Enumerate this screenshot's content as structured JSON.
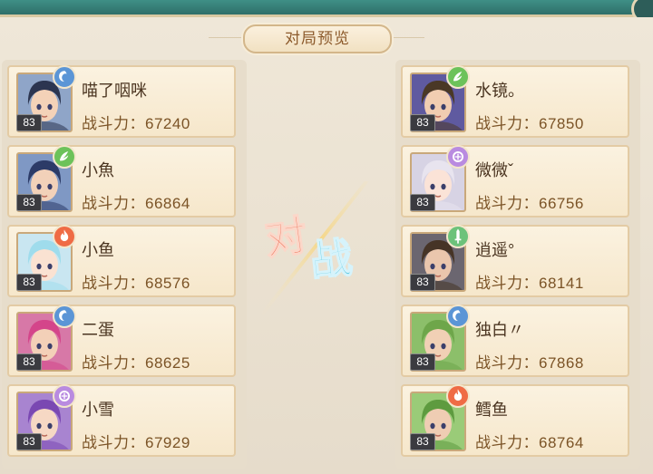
{
  "title": "对局预览",
  "power_label": "战斗力：",
  "vs_text": {
    "left": "对",
    "right": "战"
  },
  "left_team": [
    {
      "name": "喵了咽咪",
      "power": "67240",
      "level": "83",
      "element": "water",
      "element_color": "#5b95d6",
      "hair": "#2c3550",
      "skin": "#f4d2b8",
      "bg": "#8fa5c8"
    },
    {
      "name": "小魚",
      "power": "66864",
      "level": "83",
      "element": "wind",
      "element_color": "#6cc25a",
      "hair": "#2c3b67",
      "skin": "#f2d1b9",
      "bg": "#7f98c4"
    },
    {
      "name": "小鱼",
      "power": "68576",
      "level": "83",
      "element": "fire",
      "element_color": "#ef6b45",
      "hair": "#9fdcec",
      "skin": "#fae2d2",
      "bg": "#c9e6f1"
    },
    {
      "name": "二蛋",
      "power": "68625",
      "level": "83",
      "element": "water",
      "element_color": "#5b95d6",
      "hair": "#d4458a",
      "skin": "#f3d0b8",
      "bg": "#d778a7"
    },
    {
      "name": "小雪",
      "power": "67929",
      "level": "83",
      "element": "thunder",
      "element_color": "#b98be0",
      "hair": "#7a48b2",
      "skin": "#f6d8c4",
      "bg": "#a884d0"
    }
  ],
  "right_team": [
    {
      "name": "水镜。",
      "power": "67850",
      "level": "83",
      "element": "wind",
      "element_color": "#6cc25a",
      "hair": "#4a3826",
      "skin": "#f1cdb1",
      "bg": "#5f5aa0"
    },
    {
      "name": "微微ˇ",
      "power": "66756",
      "level": "83",
      "element": "thunder",
      "element_color": "#b98be0",
      "hair": "#e8e4ef",
      "skin": "#fbe3d7",
      "bg": "#d7d3e4"
    },
    {
      "name": "逍遥°",
      "power": "68141",
      "level": "83",
      "element": "sword",
      "element_color": "#6cc27a",
      "hair": "#463426",
      "skin": "#eac6ad",
      "bg": "#6b6670"
    },
    {
      "name": "独白〃",
      "power": "67868",
      "level": "83",
      "element": "water",
      "element_color": "#5b95d6",
      "hair": "#6ea64a",
      "skin": "#f1d0b5",
      "bg": "#8cbf6a"
    },
    {
      "name": "鳕鱼",
      "power": "68764",
      "level": "83",
      "element": "fire",
      "element_color": "#ef6b45",
      "hair": "#5e9b3f",
      "skin": "#efcdb3",
      "bg": "#9acb78"
    }
  ]
}
